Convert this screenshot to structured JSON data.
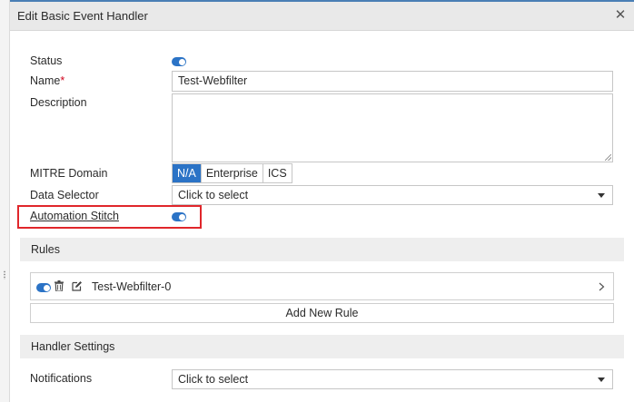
{
  "dialog": {
    "title": "Edit Basic Event Handler",
    "close_icon": "close-icon"
  },
  "form": {
    "status": {
      "label": "Status",
      "enabled": true
    },
    "name": {
      "label": "Name",
      "required_mark": "*",
      "value": "Test-Webfilter"
    },
    "description": {
      "label": "Description",
      "value": ""
    },
    "mitre_domain": {
      "label": "MITRE Domain",
      "options": [
        "N/A",
        "Enterprise",
        "ICS"
      ],
      "selected": "N/A"
    },
    "data_selector": {
      "label": "Data Selector",
      "value": "Click to select"
    },
    "automation_stitch": {
      "label": "Automation Stitch",
      "enabled": true
    }
  },
  "rules": {
    "section_title": "Rules",
    "items": [
      {
        "name": "Test-Webfilter-0",
        "enabled": true
      }
    ],
    "add_label": "Add New Rule"
  },
  "handler_settings": {
    "section_title": "Handler Settings",
    "notifications": {
      "label": "Notifications",
      "value": "Click to select"
    }
  },
  "colors": {
    "accent": "#2b73c6",
    "highlight_border": "#e0262b",
    "section_bg": "#eeeeee"
  }
}
